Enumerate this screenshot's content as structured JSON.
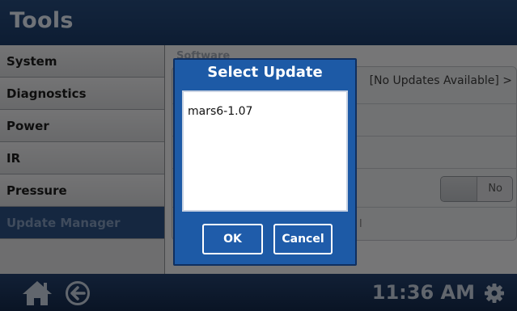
{
  "header": {
    "title": "Tools"
  },
  "sidebar": {
    "items": [
      {
        "label": "System"
      },
      {
        "label": "Diagnostics"
      },
      {
        "label": "Power"
      },
      {
        "label": "IR"
      },
      {
        "label": "Pressure"
      },
      {
        "label": "Update Manager"
      }
    ]
  },
  "panel": {
    "section_label": "Software",
    "update_value": "[No Updates Available] >",
    "toggle_value": "No",
    "row_stubs": [
      "S",
      "I",
      "I",
      "I",
      "I"
    ],
    "trailing_stub": "l"
  },
  "dialog": {
    "title": "Select Update",
    "items": [
      "mars6-1.07"
    ],
    "ok_label": "OK",
    "cancel_label": "Cancel"
  },
  "footer": {
    "time": "11:36 AM"
  },
  "colors": {
    "header_bg": "#1e416f",
    "active_item": "#2b4f81",
    "dialog_bg": "#1d5aa6"
  },
  "icons": [
    "home-icon",
    "back-arrow-icon",
    "gear-icon"
  ]
}
